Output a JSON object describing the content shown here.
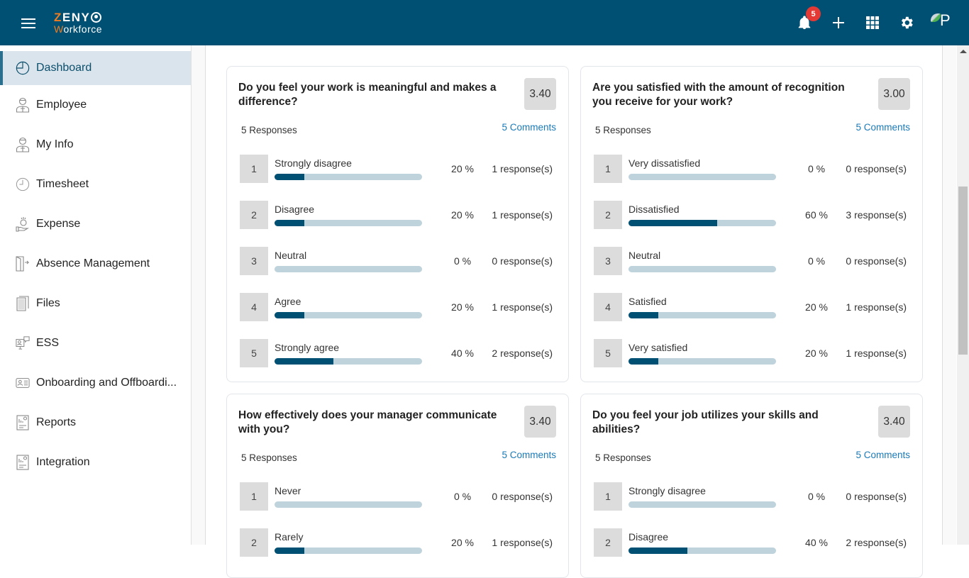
{
  "app": {
    "logo_line1_accent": "Z",
    "logo_line1_rest": "ENY",
    "logo_line2_accent": "W",
    "logo_line2_rest": "orkforce"
  },
  "header": {
    "notification_count": "5",
    "avatar_letter": "P",
    "icons": [
      "menu-icon",
      "bell-icon",
      "plus-icon",
      "apps-grid-icon",
      "gear-icon",
      "avatar"
    ]
  },
  "sidebar": {
    "items": [
      {
        "label": "Dashboard",
        "icon": "pie-chart-icon",
        "active": true
      },
      {
        "label": "Employee",
        "icon": "employee-icon"
      },
      {
        "label": "My Info",
        "icon": "person-icon"
      },
      {
        "label": "Timesheet",
        "icon": "clock-icon"
      },
      {
        "label": "Expense",
        "icon": "money-hand-icon"
      },
      {
        "label": "Absence Management",
        "icon": "door-exit-icon"
      },
      {
        "label": "Files",
        "icon": "file-icon"
      },
      {
        "label": "ESS",
        "icon": "monitor-chat-icon"
      },
      {
        "label": "Onboarding and Offboardi...",
        "icon": "id-card-icon"
      },
      {
        "label": "Reports",
        "icon": "report-icon"
      },
      {
        "label": "Integration",
        "icon": "report-icon"
      }
    ]
  },
  "questions": [
    {
      "title": "Do you feel your work is meaningful and makes a difference?",
      "score": "3.40",
      "responses": "5 Responses",
      "comments": "5 Comments",
      "options": [
        {
          "num": "1",
          "label": "Strongly disagree",
          "pct_text": "20 %",
          "pct": 20,
          "resp": "1 response(s)"
        },
        {
          "num": "2",
          "label": "Disagree",
          "pct_text": "20 %",
          "pct": 20,
          "resp": "1 response(s)"
        },
        {
          "num": "3",
          "label": "Neutral",
          "pct_text": "0 %",
          "pct": 0,
          "resp": "0 response(s)"
        },
        {
          "num": "4",
          "label": "Agree",
          "pct_text": "20 %",
          "pct": 20,
          "resp": "1 response(s)"
        },
        {
          "num": "5",
          "label": "Strongly agree",
          "pct_text": "40 %",
          "pct": 40,
          "resp": "2 response(s)"
        }
      ]
    },
    {
      "title": "Are you satisfied with the amount of recognition you receive for your work?",
      "score": "3.00",
      "responses": "5 Responses",
      "comments": "5 Comments",
      "options": [
        {
          "num": "1",
          "label": "Very dissatisfied",
          "pct_text": "0 %",
          "pct": 0,
          "resp": "0 response(s)"
        },
        {
          "num": "2",
          "label": "Dissatisfied",
          "pct_text": "60 %",
          "pct": 60,
          "resp": "3 response(s)"
        },
        {
          "num": "3",
          "label": "Neutral",
          "pct_text": "0 %",
          "pct": 0,
          "resp": "0 response(s)"
        },
        {
          "num": "4",
          "label": "Satisfied",
          "pct_text": "20 %",
          "pct": 20,
          "resp": "1 response(s)"
        },
        {
          "num": "5",
          "label": "Very satisfied",
          "pct_text": "20 %",
          "pct": 20,
          "resp": "1 response(s)"
        }
      ]
    },
    {
      "title": "How effectively does your manager communicate with you?",
      "score": "3.40",
      "responses": "5 Responses",
      "comments": "5 Comments",
      "options": [
        {
          "num": "1",
          "label": "Never",
          "pct_text": "0 %",
          "pct": 0,
          "resp": "0 response(s)"
        },
        {
          "num": "2",
          "label": "Rarely",
          "pct_text": "20 %",
          "pct": 20,
          "resp": "1 response(s)"
        }
      ]
    },
    {
      "title": "Do you feel your job utilizes your skills and abilities?",
      "score": "3.40",
      "responses": "5 Responses",
      "comments": "5 Comments",
      "options": [
        {
          "num": "1",
          "label": "Strongly disagree",
          "pct_text": "0 %",
          "pct": 0,
          "resp": "0 response(s)"
        },
        {
          "num": "2",
          "label": "Disagree",
          "pct_text": "40 %",
          "pct": 40,
          "resp": "2 response(s)"
        }
      ]
    }
  ],
  "colors": {
    "header_bg": "#005073",
    "accent_orange": "#f07c22",
    "bar_fill": "#005073",
    "bar_track": "#bfd3dd",
    "link": "#1a7ab8",
    "badge": "#e53935",
    "active_nav_bg": "#dae4ec"
  }
}
